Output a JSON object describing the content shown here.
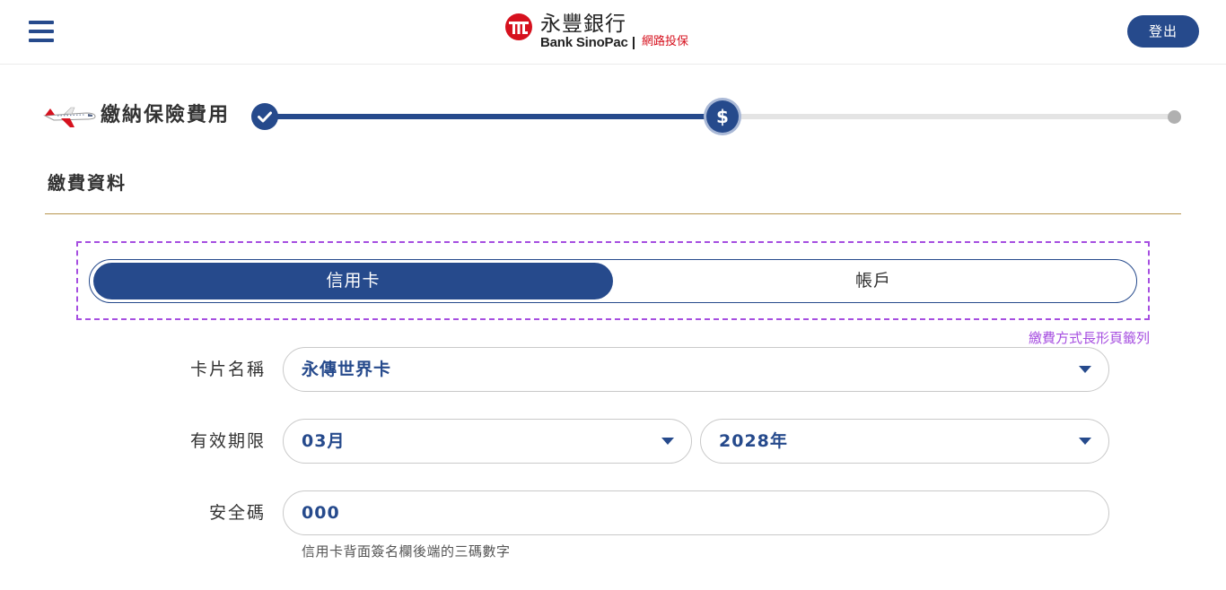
{
  "header": {
    "logo_cn": "永豐銀行",
    "logo_en": "Bank SinoPac",
    "logo_sub": "網路投保",
    "logout_label": "登出",
    "menu_icon": "hamburger-icon"
  },
  "progress": {
    "title": "繳納保險費用",
    "current_step": 2,
    "total_steps": 3,
    "step_icons": [
      "check-icon",
      "dollar-icon",
      "dot"
    ]
  },
  "section": {
    "title": "繳費資料"
  },
  "payment_tabs": {
    "items": [
      {
        "label": "信用卡",
        "active": true
      },
      {
        "label": "帳戶",
        "active": false
      }
    ],
    "note": "繳費方式長形頁籤列"
  },
  "form": {
    "card_name": {
      "label": "卡片名稱",
      "value": "永傳世界卡"
    },
    "expiry": {
      "label": "有效期限",
      "month": "03月",
      "year": "2028年"
    },
    "cvv": {
      "label": "安全碼",
      "value": "000",
      "hint": "信用卡背面簽名欄後端的三碼數字"
    }
  },
  "colors": {
    "primary": "#264a8c",
    "brand_red": "#d6111e",
    "annotation_purple": "#a64ee0",
    "divider_gold": "#b8964e"
  }
}
